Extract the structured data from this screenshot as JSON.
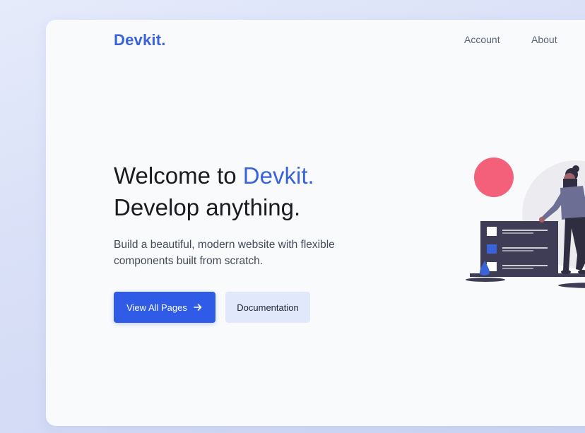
{
  "header": {
    "logo": "Devkit.",
    "nav": [
      {
        "label": "Account"
      },
      {
        "label": "About"
      }
    ]
  },
  "hero": {
    "line1_prefix": "Welcome to ",
    "line1_accent": "Devkit.",
    "line2": "Develop anything.",
    "subtitle": "Build a beautiful, modern website with flexible components built from scratch."
  },
  "buttons": {
    "primary_label": "View All Pages",
    "secondary_label": "Documentation"
  },
  "colors": {
    "accent": "#3b63d9",
    "primary_button": "#2f5be6",
    "secondary_button": "#e2e8fb",
    "illustration_pink": "#f4607a",
    "illustration_dark": "#3f3d56"
  },
  "icons": {
    "primary_button_icon": "arrow-right-icon"
  }
}
